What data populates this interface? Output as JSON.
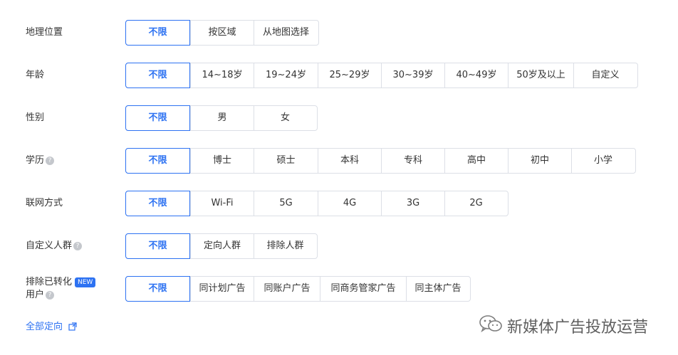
{
  "rows": [
    {
      "label": "地理位置",
      "options": [
        "不限",
        "按区域",
        "从地图选择"
      ]
    },
    {
      "label": "年龄",
      "options": [
        "不限",
        "14~18岁",
        "19~24岁",
        "25~29岁",
        "30~39岁",
        "40~49岁",
        "50岁及以上",
        "自定义"
      ]
    },
    {
      "label": "性别",
      "options": [
        "不限",
        "男",
        "女"
      ]
    },
    {
      "label": "学历",
      "options": [
        "不限",
        "博士",
        "硕士",
        "本科",
        "专科",
        "高中",
        "初中",
        "小学"
      ]
    },
    {
      "label": "联网方式",
      "options": [
        "不限",
        "Wi-Fi",
        "5G",
        "4G",
        "3G",
        "2G"
      ]
    },
    {
      "label": "自定义人群",
      "options": [
        "不限",
        "定向人群",
        "排除人群"
      ]
    },
    {
      "label_line1": "排除已转化",
      "label_line2": "用户",
      "badge": "NEW",
      "options": [
        "不限",
        "同计划广告",
        "同账户广告",
        "同商务管家广告",
        "同主体广告"
      ]
    }
  ],
  "help_glyph": "?",
  "all_targeting_link": "全部定向",
  "watermark": "新媒体广告投放运营",
  "colors": {
    "accent": "#2d72f2",
    "border": "#dcdfe6",
    "text": "#333333"
  }
}
